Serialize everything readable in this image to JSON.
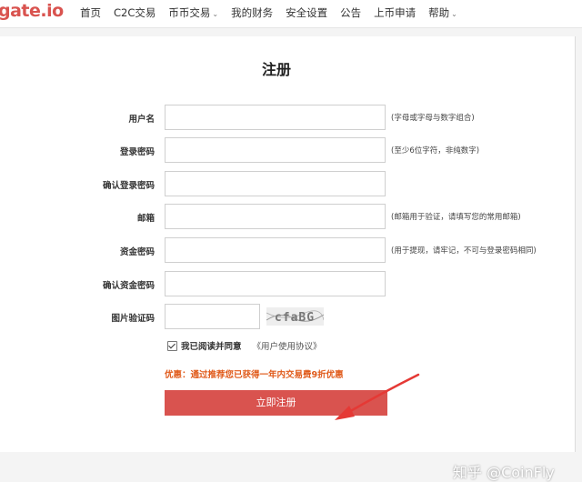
{
  "header": {
    "logo": "gate.io",
    "nav": [
      {
        "label": "首页"
      },
      {
        "label": "C2C交易"
      },
      {
        "label": "币币交易",
        "dropdown": true
      },
      {
        "label": "我的财务"
      },
      {
        "label": "安全设置"
      },
      {
        "label": "公告"
      },
      {
        "label": "上币申请"
      },
      {
        "label": "帮助",
        "dropdown": true
      }
    ]
  },
  "form": {
    "title": "注册",
    "fields": [
      {
        "label": "用户名",
        "hint": "(字母或字母与数字组合)"
      },
      {
        "label": "登录密码",
        "hint": "(至少6位字符，非纯数字)"
      },
      {
        "label": "确认登录密码",
        "hint": ""
      },
      {
        "label": "邮箱",
        "hint": "(邮箱用于验证，请填写您的常用邮箱)"
      },
      {
        "label": "资金密码",
        "hint": "(用于提现，请牢记，不可与登录密码相同)"
      },
      {
        "label": "确认资金密码",
        "hint": ""
      }
    ],
    "captcha": {
      "label": "图片验证码",
      "code": "cfaBG"
    },
    "agree": {
      "checked": true,
      "text": "我已阅读并同意",
      "link": "《用户使用协议》"
    },
    "promo": "优惠：通过推荐您已获得一年内交易费9折优惠",
    "submit": "立即注册"
  },
  "watermark": "知乎 @CoinFly",
  "colors": {
    "brand": "#d9534f",
    "promo": "#e05a1a",
    "arrow": "#e53935"
  }
}
